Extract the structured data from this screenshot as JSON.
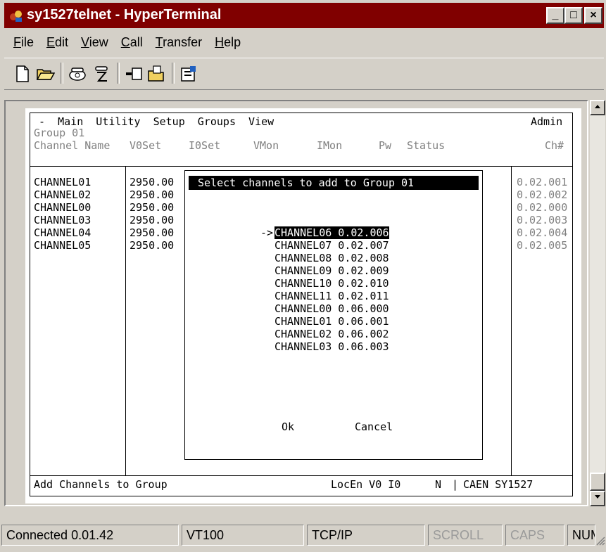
{
  "window": {
    "title": "sy1527telnet - HyperTerminal",
    "controls": {
      "minimize": "_",
      "maximize": "□",
      "close": "×"
    }
  },
  "menu": [
    {
      "pre": "",
      "ul": "F",
      "post": "ile"
    },
    {
      "pre": "",
      "ul": "E",
      "post": "dit"
    },
    {
      "pre": "",
      "ul": "V",
      "post": "iew"
    },
    {
      "pre": "",
      "ul": "C",
      "post": "all"
    },
    {
      "pre": "",
      "ul": "T",
      "post": "ransfer"
    },
    {
      "pre": "",
      "ul": "H",
      "post": "elp"
    }
  ],
  "toolbar_icons": [
    "new-icon",
    "open-icon",
    "connect-icon",
    "disconnect-icon",
    "send-icon",
    "receive-icon",
    "properties-icon"
  ],
  "terminal": {
    "menu_line": " -  Main  Utility  Setup  Groups  View",
    "user": "Admin",
    "group_label": "Group 01",
    "headers": {
      "channel_name": "Channel Name",
      "v0set": "V0Set",
      "i0set": "I0Set",
      "vmon": "VMon",
      "imon": "IMon",
      "pw": "Pw",
      "status": "Status",
      "ch": "Ch#"
    },
    "rows": [
      {
        "name": "CHANNEL01",
        "v0set": "2950.00",
        "ch": "0.02.001"
      },
      {
        "name": "CHANNEL02",
        "v0set": "2950.00",
        "ch": "0.02.002"
      },
      {
        "name": "CHANNEL00",
        "v0set": "2950.00",
        "ch": "0.02.000"
      },
      {
        "name": "CHANNEL03",
        "v0set": "2950.00",
        "ch": "0.02.003"
      },
      {
        "name": "CHANNEL04",
        "v0set": "2950.00",
        "ch": "0.02.004"
      },
      {
        "name": "CHANNEL05",
        "v0set": "2950.00",
        "ch": "0.02.005"
      }
    ],
    "dialog": {
      "title": " Select channels to add to Group 01",
      "arrow": "->",
      "items": [
        "CHANNEL06 0.02.006",
        "CHANNEL07 0.02.007",
        "CHANNEL08 0.02.008",
        "CHANNEL09 0.02.009",
        "CHANNEL10 0.02.010",
        "CHANNEL11 0.02.011",
        "CHANNEL00 0.06.000",
        "CHANNEL01 0.06.001",
        "CHANNEL02 0.06.002",
        "CHANNEL03 0.06.003"
      ],
      "selected_index": 0,
      "ok": "Ok",
      "cancel": "Cancel"
    },
    "footer": {
      "action": "Add Channels to Group",
      "locen": "LocEn V0 I0",
      "pw": "N",
      "sep": "|",
      "crate": "CAEN SY1527"
    }
  },
  "statusbar": {
    "connected": "Connected 0.01.42",
    "emulation": "VT100",
    "protocol": "TCP/IP",
    "scroll": "SCROLL",
    "caps": "CAPS",
    "num": "NUM"
  },
  "colors": {
    "titlebar": "#800000",
    "chrome": "#d4d0c8",
    "terminal_bg": "#ffffff",
    "highlight": "#000000"
  }
}
